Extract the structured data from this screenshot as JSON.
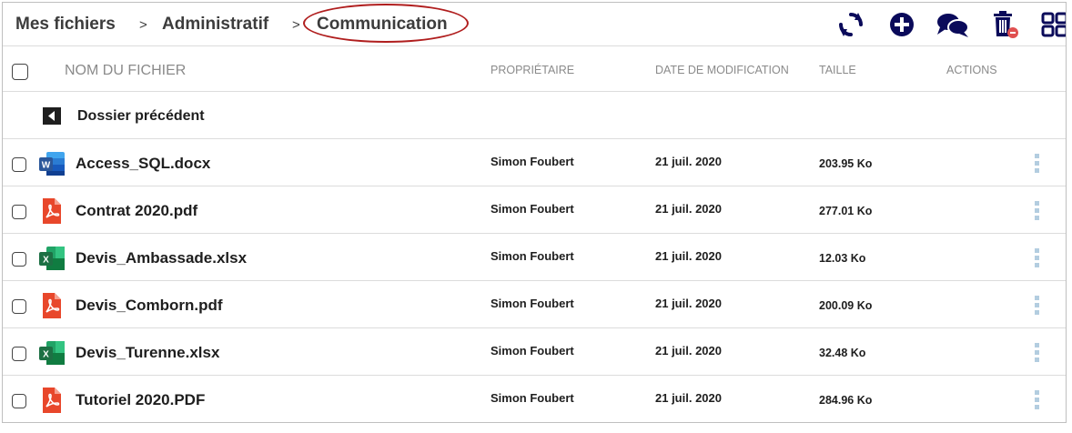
{
  "breadcrumb": {
    "items": [
      "Mes fichiers",
      "Administratif",
      "Communication"
    ],
    "separator": ">"
  },
  "toolbar": {
    "icons": [
      "refresh-icon",
      "add-circle-icon",
      "chat-bubbles-icon",
      "trash-icon",
      "grid-view-icon"
    ],
    "icon_color": "#0a0a5a",
    "trash_badge_color": "#e05050"
  },
  "table": {
    "columns": {
      "name": "NOM DU FICHIER",
      "owner": "PROPRIÉTAIRE",
      "date": "DATE DE MODIFICATION",
      "size": "TAILLE",
      "actions": "ACTIONS"
    },
    "back_label": "Dossier précédent",
    "rows": [
      {
        "name": "Access_SQL.docx",
        "type": "word",
        "owner": "Simon Foubert",
        "date": "21 juil. 2020",
        "size": "203.95 Ko"
      },
      {
        "name": "Contrat 2020.pdf",
        "type": "pdf",
        "owner": "Simon Foubert",
        "date": "21 juil. 2020",
        "size": "277.01 Ko"
      },
      {
        "name": "Devis_Ambassade.xlsx",
        "type": "excel",
        "owner": "Simon Foubert",
        "date": "21 juil. 2020",
        "size": "12.03 Ko"
      },
      {
        "name": "Devis_Comborn.pdf",
        "type": "pdf",
        "owner": "Simon Foubert",
        "date": "21 juil. 2020",
        "size": "200.09 Ko"
      },
      {
        "name": "Devis_Turenne.xlsx",
        "type": "excel",
        "owner": "Simon Foubert",
        "date": "21 juil. 2020",
        "size": "32.48 Ko"
      },
      {
        "name": "Tutoriel 2020.PDF",
        "type": "pdf",
        "owner": "Simon Foubert",
        "date": "21 juil. 2020",
        "size": "284.96 Ko"
      }
    ]
  },
  "colors": {
    "highlight_ellipse": "#b01e1e",
    "pdf_red": "#e8472b",
    "excel_green": "#1d7044",
    "word_blue": "#2b579a",
    "kebab_dot": "#b3cde0"
  }
}
